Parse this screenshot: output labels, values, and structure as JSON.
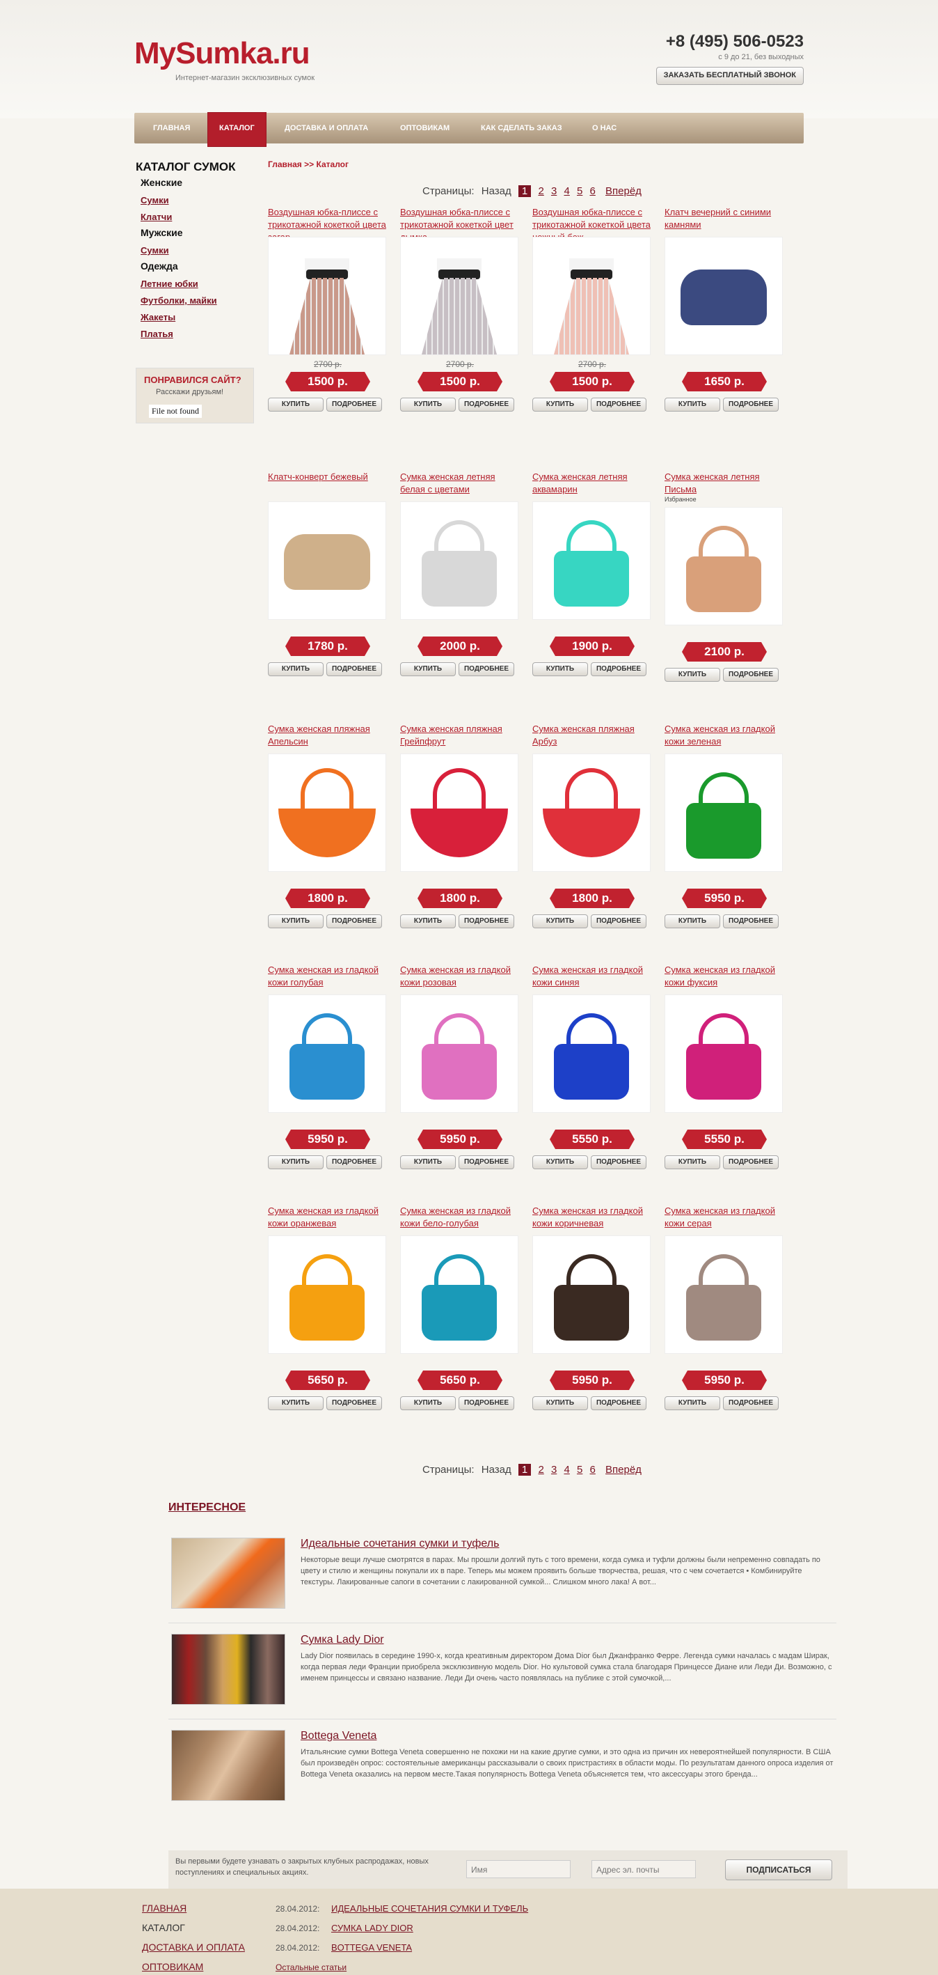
{
  "header": {
    "logo": "MySumka.ru",
    "tagline": "Интернет-магазин эксклюзивных сумок",
    "phone": "+8 (495) 506-0523",
    "hours": "с 9 до 21, без выходных",
    "callback_label": "ЗАКАЗАТЬ БЕСПЛАТНЫЙ ЗВОНОК"
  },
  "nav": [
    "ГЛАВНАЯ",
    "КАТАЛОГ",
    "ДОСТАВКА И ОПЛАТА",
    "ОПТОВИКАМ",
    "КАК СДЕЛАТЬ ЗАКАЗ",
    "О НАС"
  ],
  "sidebar": {
    "title": "КАТАЛОГ СУМОК",
    "women": "Женские",
    "women_items": [
      "Сумки",
      "Клатчи"
    ],
    "men": "Мужские",
    "men_items": [
      "Сумки"
    ],
    "clothes": "Одежда",
    "clothes_items": [
      "Летние юбки",
      "Футболки, майки",
      "Жакеты",
      "Платья"
    ],
    "like_title": "ПОНРАВИЛСЯ САЙТ?",
    "like_sub": "Расскажи друзьям!",
    "like_error": "File not found"
  },
  "breadcrumb": {
    "home": "Главная",
    "sep": ">>",
    "current": "Каталог"
  },
  "pager": {
    "label": "Страницы:",
    "back": "Назад",
    "pages": [
      "1",
      "2",
      "3",
      "4",
      "5",
      "6"
    ],
    "next": "Вперёд"
  },
  "buttons": {
    "buy": "КУПИТЬ",
    "details": "ПОДРОБНЕЕ"
  },
  "products": [
    {
      "title": "Воздушная юбка-плиссе с трикотажной кокеткой цвета загар",
      "old": "2700 р.",
      "price": "1500 р.",
      "kind": "skirt",
      "color": "#c9998a"
    },
    {
      "title": "Воздушная юбка-плиссе с трикотажной кокеткой цвет дымка",
      "old": "2700 р.",
      "price": "1500 р.",
      "kind": "skirt",
      "color": "#c7bfc4"
    },
    {
      "title": "Воздушная юбка-плиссе с трикотажной кокеткой цвета нежный беж",
      "old": "2700 р.",
      "price": "1500 р.",
      "kind": "skirt",
      "color": "#efc0b5"
    },
    {
      "title": "Клатч вечерний с синими камнями",
      "old": "",
      "price": "1650 р.",
      "kind": "clutch",
      "color": "#3b4a80"
    },
    {
      "title": "Клатч-конверт бежевый",
      "old": "",
      "price": "1780 р.",
      "kind": "clutch",
      "color": "#cfb08a"
    },
    {
      "title": "Сумка женская летняя белая с цветами",
      "old": "",
      "price": "2000 р.",
      "kind": "bag",
      "color": "#d8d8d8"
    },
    {
      "title": "Сумка женская летняя аквамарин",
      "old": "",
      "price": "1900 р.",
      "kind": "bag",
      "color": "#37d6c2"
    },
    {
      "title": "Сумка женская летняя Письма",
      "note": "Избранное",
      "old": "",
      "price": "2100 р.",
      "kind": "bag",
      "color": "#d9a07a"
    },
    {
      "title": "Сумка женская пляжная Апельсин",
      "old": "",
      "price": "1800 р.",
      "kind": "beach",
      "color": "#f07020"
    },
    {
      "title": "Сумка женская пляжная Грейпфрут",
      "old": "",
      "price": "1800 р.",
      "kind": "beach",
      "color": "#d8203a"
    },
    {
      "title": "Сумка женская пляжная Арбуз",
      "old": "",
      "price": "1800 р.",
      "kind": "beach",
      "color": "#e0303a"
    },
    {
      "title": "Сумка женская из гладкой кожи зеленая",
      "old": "",
      "price": "5950 р.",
      "kind": "bag",
      "color": "#1a9a2c"
    },
    {
      "title": "Сумка женская из гладкой кожи голубая",
      "old": "",
      "price": "5950 р.",
      "kind": "bag",
      "color": "#2a8fd0"
    },
    {
      "title": "Сумка женская из гладкой кожи розовая",
      "old": "",
      "price": "5950 р.",
      "kind": "bag",
      "color": "#e070c0"
    },
    {
      "title": "Сумка женская из гладкой кожи синяя",
      "old": "",
      "price": "5550 р.",
      "kind": "bag",
      "color": "#1d40c8"
    },
    {
      "title": "Сумка женская из гладкой кожи фуксия",
      "old": "",
      "price": "5550 р.",
      "kind": "bag",
      "color": "#d0207a"
    },
    {
      "title": "Сумка женская из гладкой кожи оранжевая",
      "old": "",
      "price": "5650 р.",
      "kind": "bag",
      "color": "#f5a010"
    },
    {
      "title": "Сумка женская из гладкой кожи бело-голубая",
      "old": "",
      "price": "5650 р.",
      "kind": "bag",
      "color": "#1a9ab8"
    },
    {
      "title": "Сумка женская из гладкой кожи коричневая",
      "old": "",
      "price": "5950 р.",
      "kind": "bag",
      "color": "#3a2a22"
    },
    {
      "title": "Сумка женская из гладкой кожи серая",
      "old": "",
      "price": "5950 р.",
      "kind": "bag",
      "color": "#a08a80"
    }
  ],
  "interesting": {
    "title": "ИНТЕРЕСНОЕ",
    "articles": [
      {
        "title": "Идеальные сочетания сумки и туфель",
        "text": "Некоторые вещи лучше смотрятся в парах. Мы прошли долгий путь с того времени, когда сумка и туфли должны были непременно совпадать по цвету и стилю и женщины покупали их в паре. Теперь мы можем проявить больше творчества, решая, что с чем сочетается • Комбинируйте текстуры. Лакированные сапоги в сочетании с лакированной сумкой... Слишком много лака! А вот..."
      },
      {
        "title": "Сумка Lady Dior",
        "text": "Lady Dior появилась в середине 1990-х, когда креативным директором Дома Dior был Джанфранко Ферре. Легенда сумки началась с мадам Ширак, когда первая леди Франции приобрела эксклюзивную модель Dior. Но культовой сумка стала благодаря Принцессе Диане или Леди Ди. Возможно, с именем принцессы и связано название. Леди Ди очень часто появлялась на публике с этой сумочкой,..."
      },
      {
        "title": "Bottega Veneta",
        "text": "Итальянские сумки Bottega Veneta совершенно не похожи ни на какие другие сумки, и это одна из причин их невероятнейшей популярности. В США был произведён опрос: состоятельные американцы рассказывали о своих пристрастиях в области моды. По результатам данного опроса изделия от Bottega Veneta оказались на первом месте.Такая популярность Bottega Veneta объясняется тем, что аксессуары этого бренда..."
      }
    ]
  },
  "subscribe": {
    "text": "Вы первыми будете узнавать о закрытых клубных распродажах, новых поступлениях и специальных акциях.",
    "name_placeholder": "Имя",
    "email_placeholder": "Адрес эл. почты",
    "button": "ПОДПИСАТЬСЯ"
  },
  "footer": {
    "nav": [
      "ГЛАВНАЯ",
      "КАТАЛОГ",
      "ДОСТАВКА И ОПЛАТА",
      "ОПТОВИКАМ"
    ],
    "news": [
      {
        "date": "28.04.2012:",
        "title": "ИДЕАЛЬНЫЕ СОЧЕТАНИЯ СУМКИ И ТУФЕЛЬ"
      },
      {
        "date": "28.04.2012:",
        "title": "СУМКА LADY DIOR"
      },
      {
        "date": "28.04.2012:",
        "title": "BOTTEGA VENETA"
      }
    ],
    "other": "Остальные статьи"
  }
}
